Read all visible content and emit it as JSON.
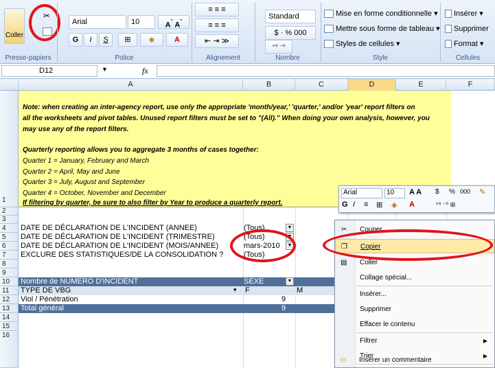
{
  "ribbon": {
    "font_name": "Arial",
    "font_size": "10",
    "paste_label": "Coller",
    "bold": "G",
    "italic": "I",
    "underline": "S",
    "number_format": "Standard",
    "pct": "%",
    "thousands": "000",
    "styles": [
      "Mise en forme conditionnelle",
      "Mettre sous forme de tableau",
      "Styles de cellules"
    ],
    "cells": [
      "Insérer",
      "Supprimer",
      "Format"
    ],
    "groups": [
      "Presse-papiers",
      "Police",
      "Alignement",
      "Nombre",
      "Style",
      "Cellules"
    ]
  },
  "formula_bar": {
    "name_box": "D12",
    "fx": "fx",
    "formula": ""
  },
  "columns": [
    "A",
    "B",
    "C",
    "D",
    "E",
    "F"
  ],
  "rows": [
    "1",
    "2",
    "3",
    "4",
    "5",
    "6",
    "7",
    "8",
    "9",
    "10",
    "11",
    "12",
    "13",
    "14",
    "15",
    "16"
  ],
  "note": [
    "Note: when creating an inter-agency report, use only the appropriate 'month/year,' 'quarter,' and/or 'year' report filters on",
    "all the worksheets and pivot tables.  Unused report filters must be set to \"(All).\" When doing your own analysis, however, you",
    "may use any of the report filters.",
    "",
    "Quarterly reporting allows you to aggregate 3 months of cases together:",
    "Quarter 1 = January, February and March",
    "Quarter 2 = April, May and June",
    "Quarter 3 = July, August and September",
    "Quarter 4 = October, November and December",
    "If filtering by quarter, be sure to also filter by Year to produce a quarterly report."
  ],
  "filters": [
    {
      "label": "DATE DE DÉCLARATION DE L'INCIDENT (ANNEE)",
      "value": "(Tous)"
    },
    {
      "label": "DATE DE DÉCLARATION DE L'INCIDENT (TRIMESTRE)",
      "value": "(Tous)"
    },
    {
      "label": "DATE DE DÉCLARATION DE L'INCIDENT (MOIS/ANNEE)",
      "value": "mars-2010"
    },
    {
      "label": "EXCLURE DES STATISTIQUES/DE LA CONSOLIDATION ?",
      "value": "(Tous)"
    }
  ],
  "pivot": {
    "measure": "Nombre de NUMERO D'INCIDENT",
    "col_field": "SEXE",
    "row_field": "TYPE DE VBG",
    "col_f": "F",
    "col_m": "M",
    "row_label": "Viol / Pénétration",
    "row_value": "9",
    "total_label": "Total général",
    "total_value": "9"
  },
  "mini_toolbar": {
    "font": "Arial",
    "size": "10",
    "bold": "G",
    "italic": "I",
    "currency": "$",
    "pct": "%",
    "thousands": "000"
  },
  "context_menu": [
    "Couper",
    "Copier",
    "Coller",
    "Collage spécial...",
    "Insérer...",
    "Supprimer",
    "Effacer le contenu",
    "Filtrer",
    "Trier",
    "Insérer un commentaire"
  ],
  "colors": {
    "accent": "#e0141a",
    "note_bg": "#ffff99",
    "pivot_header": "#4f6f9a",
    "highlight": "#fde9a8"
  }
}
